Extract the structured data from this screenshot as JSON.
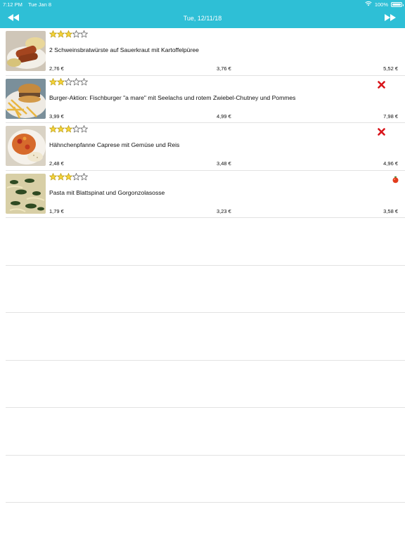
{
  "status_bar": {
    "time": "7:12 PM",
    "date": "Tue Jan 8",
    "battery_text": "100%",
    "battery_level": 1.0
  },
  "nav": {
    "title": "Tue, 12/11/18",
    "prev_icon": "rewind-icon",
    "next_icon": "fast-forward-icon"
  },
  "colors": {
    "header_bg": "#2ebfd6",
    "star_fill": "#f5d33a",
    "star_outline": "#555555",
    "separator": "#e2e2e2"
  },
  "dishes": [
    {
      "name": "2 Schweinsbratwürste auf Sauerkraut mit Kartoffelpüree",
      "rating": 3,
      "max_rating": 5,
      "prices": [
        "2,76 €",
        "3,76 €",
        "5,52 €"
      ],
      "badge": "",
      "image": "sausage-plate-photo"
    },
    {
      "name": "Burger-Aktion: Fischburger \"a mare\" mit Seelachs und rotem Zwiebel-Chutney und Pommes",
      "rating": 2,
      "max_rating": 5,
      "prices": [
        "3,99 €",
        "4,99 €",
        "7,98 €"
      ],
      "badge": "no-pork-icon",
      "image": "burger-fries-photo"
    },
    {
      "name": "Hähnchenpfanne Caprese mit Gemüse und Reis",
      "rating": 3,
      "max_rating": 5,
      "prices": [
        "2,48 €",
        "3,48 €",
        "4,96 €"
      ],
      "badge": "no-pork-icon",
      "image": "chicken-rice-photo"
    },
    {
      "name": "Pasta mit Blattspinat und Gorgonzolasosse",
      "rating": 3,
      "max_rating": 5,
      "prices": [
        "1,79 €",
        "3,23 €",
        "3,58 €"
      ],
      "badge": "vegetarian-tomato-icon",
      "image": "spinach-pasta-photo"
    }
  ]
}
